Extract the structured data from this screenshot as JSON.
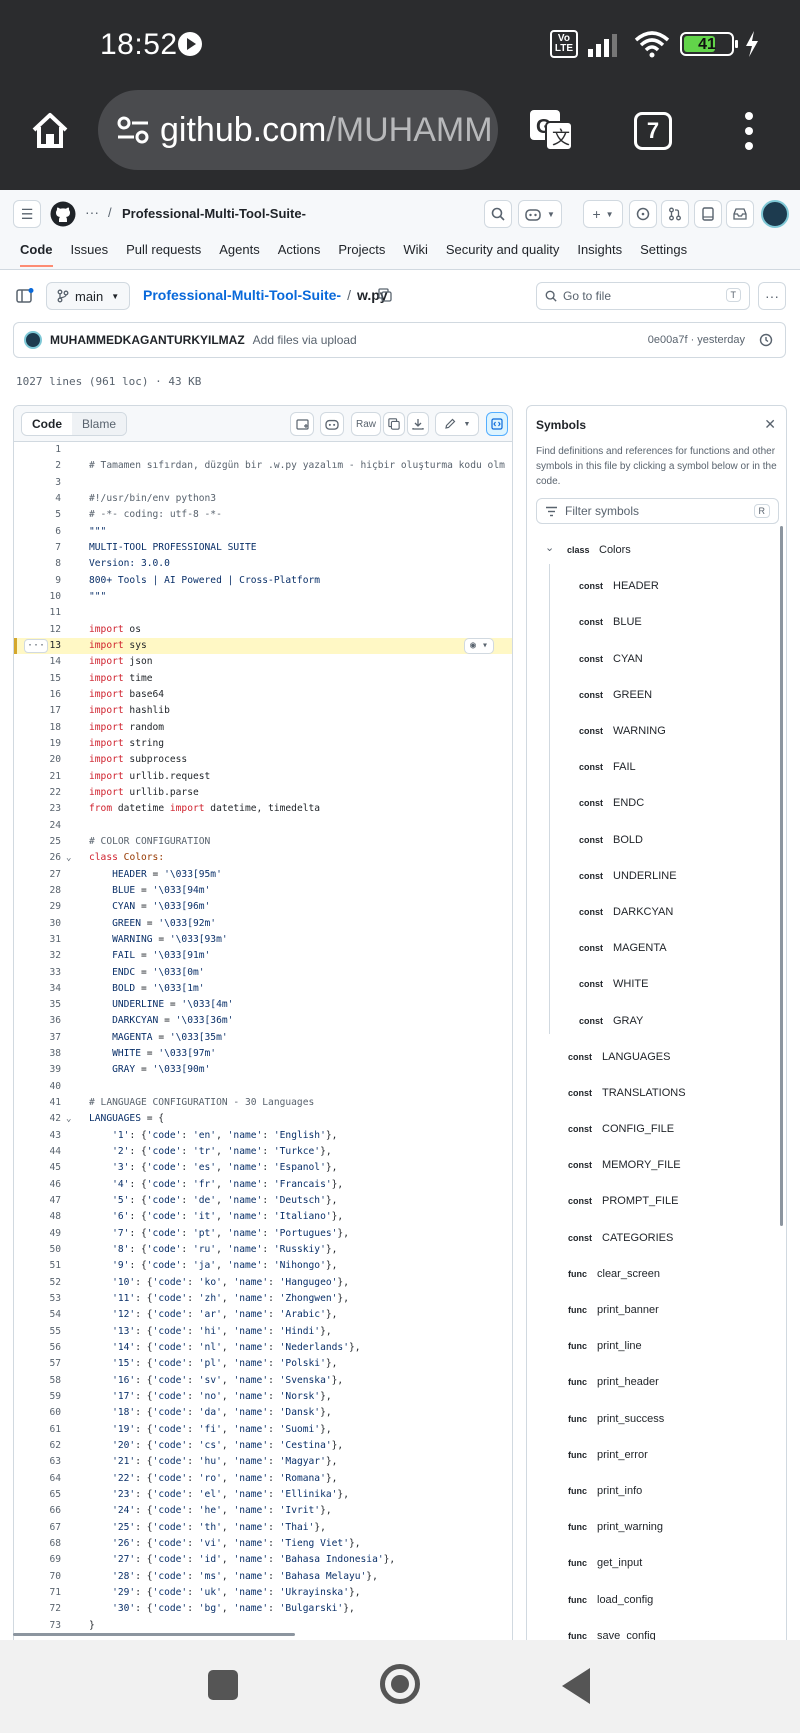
{
  "status_bar": {
    "time": "18:52",
    "network": "VoLTE",
    "battery": "41"
  },
  "browser": {
    "url_host": "github.com",
    "url_path": "/MUHAMM",
    "tab_count": "7"
  },
  "github": {
    "repo": "Professional-Multi-Tool-Suite-",
    "ellipsis": "···",
    "tabs": [
      "Code",
      "Issues",
      "Pull requests",
      "Agents",
      "Actions",
      "Projects",
      "Wiki",
      "Security and quality",
      "Insights",
      "Settings"
    ]
  },
  "file": {
    "branch": "main",
    "repo_link": "Professional-Multi-Tool-Suite-",
    "filename": "w.py",
    "goto_placeholder": "Go to file",
    "goto_key": "T",
    "commit_author": "MUHAMMEDKAGANTURKYILMAZ",
    "commit_message": "Add files via upload",
    "commit_meta": "0e00a7f · yesterday",
    "file_info": "1027 lines (961 loc) · 43 KB"
  },
  "code_toolbar": {
    "code_tab": "Code",
    "blame_tab": "Blame",
    "raw": "Raw"
  },
  "code_lines": [
    {
      "n": "1",
      "t": ""
    },
    {
      "n": "2",
      "t": "# Tamamen sıfırdan, düzgün bir .w.py yazalım - hiçbir oluşturma kodu olm"
    },
    {
      "n": "3",
      "t": ""
    },
    {
      "n": "4",
      "t": "#!/usr/bin/env python3"
    },
    {
      "n": "5",
      "t": "# -*- coding: utf-8 -*-"
    },
    {
      "n": "6",
      "t": "\"\"\""
    },
    {
      "n": "7",
      "t": "MULTI-TOOL PROFESSIONAL SUITE"
    },
    {
      "n": "8",
      "t": "Version: 3.0.0"
    },
    {
      "n": "9",
      "t": "800+ Tools | AI Powered | Cross-Platform"
    },
    {
      "n": "10",
      "t": "\"\"\""
    },
    {
      "n": "11",
      "t": ""
    },
    {
      "n": "12",
      "t": "import os"
    },
    {
      "n": "13",
      "t": "import sys"
    },
    {
      "n": "14",
      "t": "import json"
    },
    {
      "n": "15",
      "t": "import time"
    },
    {
      "n": "16",
      "t": "import base64"
    },
    {
      "n": "17",
      "t": "import hashlib"
    },
    {
      "n": "18",
      "t": "import random"
    },
    {
      "n": "19",
      "t": "import string"
    },
    {
      "n": "20",
      "t": "import subprocess"
    },
    {
      "n": "21",
      "t": "import urllib.request"
    },
    {
      "n": "22",
      "t": "import urllib.parse"
    },
    {
      "n": "23",
      "t": "from datetime import datetime, timedelta"
    },
    {
      "n": "24",
      "t": ""
    },
    {
      "n": "25",
      "t": "# COLOR CONFIGURATION"
    },
    {
      "n": "26",
      "t": "class Colors:"
    },
    {
      "n": "27",
      "t": "    HEADER = '\\033[95m'"
    },
    {
      "n": "28",
      "t": "    BLUE = '\\033[94m'"
    },
    {
      "n": "29",
      "t": "    CYAN = '\\033[96m'"
    },
    {
      "n": "30",
      "t": "    GREEN = '\\033[92m'"
    },
    {
      "n": "31",
      "t": "    WARNING = '\\033[93m'"
    },
    {
      "n": "32",
      "t": "    FAIL = '\\033[91m'"
    },
    {
      "n": "33",
      "t": "    ENDC = '\\033[0m'"
    },
    {
      "n": "34",
      "t": "    BOLD = '\\033[1m'"
    },
    {
      "n": "35",
      "t": "    UNDERLINE = '\\033[4m'"
    },
    {
      "n": "36",
      "t": "    DARKCYAN = '\\033[36m'"
    },
    {
      "n": "37",
      "t": "    MAGENTA = '\\033[35m'"
    },
    {
      "n": "38",
      "t": "    WHITE = '\\033[97m'"
    },
    {
      "n": "39",
      "t": "    GRAY = '\\033[90m'"
    },
    {
      "n": "40",
      "t": ""
    },
    {
      "n": "41",
      "t": "# LANGUAGE CONFIGURATION - 30 Languages"
    },
    {
      "n": "42",
      "t": "LANGUAGES = {"
    },
    {
      "n": "43",
      "t": "    '1': {'code': 'en', 'name': 'English'},"
    },
    {
      "n": "44",
      "t": "    '2': {'code': 'tr', 'name': 'Turkce'},"
    },
    {
      "n": "45",
      "t": "    '3': {'code': 'es', 'name': 'Espanol'},"
    },
    {
      "n": "46",
      "t": "    '4': {'code': 'fr', 'name': 'Francais'},"
    },
    {
      "n": "47",
      "t": "    '5': {'code': 'de', 'name': 'Deutsch'},"
    },
    {
      "n": "48",
      "t": "    '6': {'code': 'it', 'name': 'Italiano'},"
    },
    {
      "n": "49",
      "t": "    '7': {'code': 'pt', 'name': 'Portugues'},"
    },
    {
      "n": "50",
      "t": "    '8': {'code': 'ru', 'name': 'Russkiy'},"
    },
    {
      "n": "51",
      "t": "    '9': {'code': 'ja', 'name': 'Nihongo'},"
    },
    {
      "n": "52",
      "t": "    '10': {'code': 'ko', 'name': 'Hangugeo'},"
    },
    {
      "n": "53",
      "t": "    '11': {'code': 'zh', 'name': 'Zhongwen'},"
    },
    {
      "n": "54",
      "t": "    '12': {'code': 'ar', 'name': 'Arabic'},"
    },
    {
      "n": "55",
      "t": "    '13': {'code': 'hi', 'name': 'Hindi'},"
    },
    {
      "n": "56",
      "t": "    '14': {'code': 'nl', 'name': 'Nederlands'},"
    },
    {
      "n": "57",
      "t": "    '15': {'code': 'pl', 'name': 'Polski'},"
    },
    {
      "n": "58",
      "t": "    '16': {'code': 'sv', 'name': 'Svenska'},"
    },
    {
      "n": "59",
      "t": "    '17': {'code': 'no', 'name': 'Norsk'},"
    },
    {
      "n": "60",
      "t": "    '18': {'code': 'da', 'name': 'Dansk'},"
    },
    {
      "n": "61",
      "t": "    '19': {'code': 'fi', 'name': 'Suomi'},"
    },
    {
      "n": "62",
      "t": "    '20': {'code': 'cs', 'name': 'Cestina'},"
    },
    {
      "n": "63",
      "t": "    '21': {'code': 'hu', 'name': 'Magyar'},"
    },
    {
      "n": "64",
      "t": "    '22': {'code': 'ro', 'name': 'Romana'},"
    },
    {
      "n": "65",
      "t": "    '23': {'code': 'el', 'name': 'Ellinika'},"
    },
    {
      "n": "66",
      "t": "    '24': {'code': 'he', 'name': 'Ivrit'},"
    },
    {
      "n": "67",
      "t": "    '25': {'code': 'th', 'name': 'Thai'},"
    },
    {
      "n": "68",
      "t": "    '26': {'code': 'vi', 'name': 'Tieng Viet'},"
    },
    {
      "n": "69",
      "t": "    '27': {'code': 'id', 'name': 'Bahasa Indonesia'},"
    },
    {
      "n": "70",
      "t": "    '28': {'code': 'ms', 'name': 'Bahasa Melayu'},"
    },
    {
      "n": "71",
      "t": "    '29': {'code': 'uk', 'name': 'Ukrayinska'},"
    },
    {
      "n": "72",
      "t": "    '30': {'code': 'bg', 'name': 'Bulgarski'},"
    },
    {
      "n": "73",
      "t": "}"
    }
  ],
  "highlighted_line": "13",
  "symbols": {
    "title": "Symbols",
    "description": "Find definitions and references for functions and other symbols in this file by clicking a symbol below or in the code.",
    "filter_placeholder": "Filter symbols",
    "filter_key": "R",
    "items": [
      {
        "kind": "class",
        "name": "Colors",
        "level": 0,
        "expanded": true
      },
      {
        "kind": "const",
        "name": "HEADER",
        "level": 1
      },
      {
        "kind": "const",
        "name": "BLUE",
        "level": 1
      },
      {
        "kind": "const",
        "name": "CYAN",
        "level": 1
      },
      {
        "kind": "const",
        "name": "GREEN",
        "level": 1
      },
      {
        "kind": "const",
        "name": "WARNING",
        "level": 1
      },
      {
        "kind": "const",
        "name": "FAIL",
        "level": 1
      },
      {
        "kind": "const",
        "name": "ENDC",
        "level": 1
      },
      {
        "kind": "const",
        "name": "BOLD",
        "level": 1
      },
      {
        "kind": "const",
        "name": "UNDERLINE",
        "level": 1
      },
      {
        "kind": "const",
        "name": "DARKCYAN",
        "level": 1
      },
      {
        "kind": "const",
        "name": "MAGENTA",
        "level": 1
      },
      {
        "kind": "const",
        "name": "WHITE",
        "level": 1
      },
      {
        "kind": "const",
        "name": "GRAY",
        "level": 1
      },
      {
        "kind": "const",
        "name": "LANGUAGES",
        "level": 0
      },
      {
        "kind": "const",
        "name": "TRANSLATIONS",
        "level": 0
      },
      {
        "kind": "const",
        "name": "CONFIG_FILE",
        "level": 0
      },
      {
        "kind": "const",
        "name": "MEMORY_FILE",
        "level": 0
      },
      {
        "kind": "const",
        "name": "PROMPT_FILE",
        "level": 0
      },
      {
        "kind": "const",
        "name": "CATEGORIES",
        "level": 0
      },
      {
        "kind": "func",
        "name": "clear_screen",
        "level": 0
      },
      {
        "kind": "func",
        "name": "print_banner",
        "level": 0
      },
      {
        "kind": "func",
        "name": "print_line",
        "level": 0
      },
      {
        "kind": "func",
        "name": "print_header",
        "level": 0
      },
      {
        "kind": "func",
        "name": "print_success",
        "level": 0
      },
      {
        "kind": "func",
        "name": "print_error",
        "level": 0
      },
      {
        "kind": "func",
        "name": "print_info",
        "level": 0
      },
      {
        "kind": "func",
        "name": "print_warning",
        "level": 0
      },
      {
        "kind": "func",
        "name": "get_input",
        "level": 0
      },
      {
        "kind": "func",
        "name": "load_config",
        "level": 0
      },
      {
        "kind": "func",
        "name": "save_config",
        "level": 0
      }
    ]
  },
  "colors": {
    "accent_link": "#0969da",
    "tab_underline": "#fd8c73",
    "highlight": "#fff8c5"
  }
}
